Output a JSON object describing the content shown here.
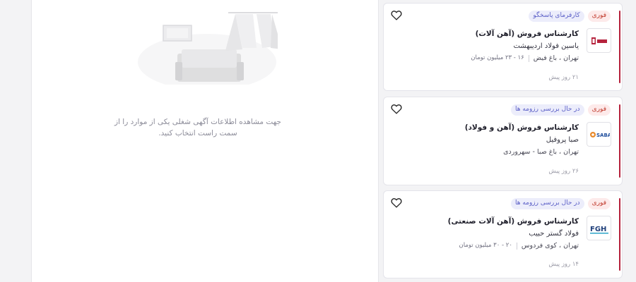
{
  "detail_panel": {
    "empty_message": "جهت مشاهده اطلاعات آگهی شغلی یکی از موارد را از سمت راست انتخاب کنید."
  },
  "jobs": [
    {
      "badge_urgent": "فوری",
      "badge_status": "کارفرمای پاسخگو",
      "title": "کارشناس فروش (آهن آلات)",
      "company": "یاسین فولاد اردیبهشت",
      "location": "تهران ، باغ فیض",
      "salary": "۱۶ - ۲۳ میلیون تومان",
      "posted": "۲۱ روز پیش",
      "logo_icon": "yasin-steel-logo"
    },
    {
      "badge_urgent": "فوری",
      "badge_status": "در حال بررسی رزومه ها",
      "title": "کارشناس فروش (آهن و فولاد)",
      "company": "صبا پروفیل",
      "location": "تهران ، باغ صبا - سهروردی",
      "salary": "",
      "posted": "۲۶ روز پیش",
      "logo_icon": "saba-logo"
    },
    {
      "badge_urgent": "فوری",
      "badge_status": "در حال بررسی رزومه ها",
      "title": "کارشناس فروش (آهن آلات صنعتی)",
      "company": "فولاد گستر حبیب",
      "location": "تهران ، کوی فردوس",
      "salary": "۲۰ - ۳۰ میلیون تومان",
      "posted": "۱۴ روز پیش",
      "logo_icon": "fgh-logo"
    }
  ],
  "logos": {
    "saba_text": "SABA",
    "fgh_text": "FGH"
  },
  "colors": {
    "accent": "#b5223c",
    "badge_urgent_text": "#c0392b",
    "badge_status_text": "#5b5fc7"
  }
}
